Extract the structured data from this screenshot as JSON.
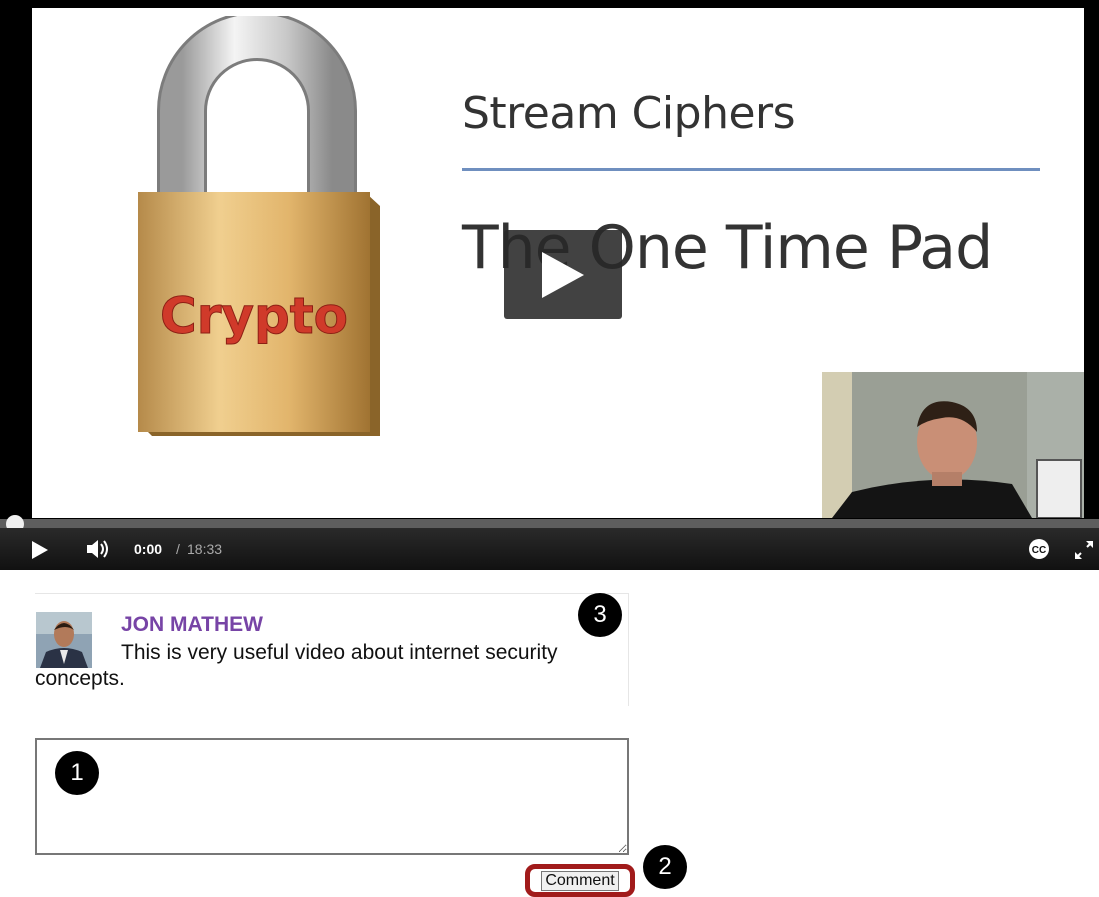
{
  "video": {
    "slide": {
      "lock_label": "Crypto",
      "title": "Stream Ciphers",
      "subtitle": "The One Time Pad"
    },
    "controls": {
      "current_time": "0:00",
      "separator": "/",
      "total_time": "18:33",
      "cc_label": "CC",
      "progress": 0
    }
  },
  "comment": {
    "author": "JON MATHEW",
    "text": "This is very useful video about internet security concepts."
  },
  "form": {
    "button_label": "Comment",
    "input_value": ""
  },
  "callouts": {
    "one": "1",
    "two": "2",
    "three": "3"
  },
  "colors": {
    "author": "#7744a6",
    "button_highlight": "#a11b1b",
    "slide_rule": "#6f8fbf"
  }
}
